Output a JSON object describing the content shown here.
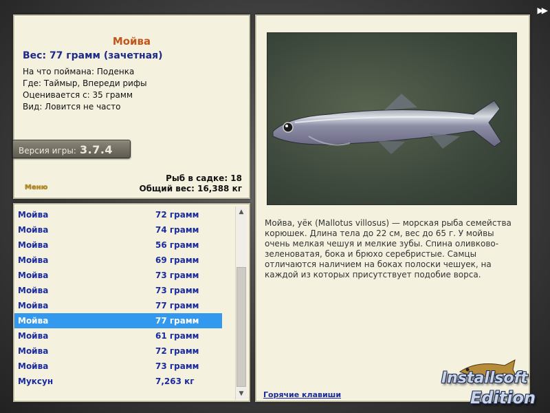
{
  "nav": {
    "arrows": "▶▶"
  },
  "info": {
    "fish_name": "Мойва",
    "weight_line": "Вес: 77 грамм (зачетная)",
    "lines": [
      "На что поймана: Поденка",
      "Где: Таймыр, Впереди рифы",
      "Оценивается с: 35 грамм",
      "Вид: Ловится не часто"
    ],
    "version_label": "Версия игры:",
    "version_number": "3.7.4",
    "menu_link": "Меню",
    "fish_in_cage": "Рыб в садке: 18",
    "total_weight": "Общий вес: 16,388 кг"
  },
  "catch_list": {
    "selected_index": 7,
    "rows": [
      {
        "name": "Мойва",
        "weight": "72 грамм"
      },
      {
        "name": "Мойва",
        "weight": "74 грамм"
      },
      {
        "name": "Мойва",
        "weight": "56 грамм"
      },
      {
        "name": "Мойва",
        "weight": "69 грамм"
      },
      {
        "name": "Мойва",
        "weight": "73 грамм"
      },
      {
        "name": "Мойва",
        "weight": "73 грамм"
      },
      {
        "name": "Мойва",
        "weight": "77 грамм"
      },
      {
        "name": "Мойва",
        "weight": "77 грамм"
      },
      {
        "name": "Мойва",
        "weight": "61 грамм"
      },
      {
        "name": "Мойва",
        "weight": "72 грамм"
      },
      {
        "name": "Мойва",
        "weight": "73 грамм"
      },
      {
        "name": "Муксун",
        "weight": "7,263 кг"
      }
    ],
    "scroll_up_glyph": "▲",
    "scroll_down_glyph": "▼"
  },
  "detail": {
    "description": "Мойва, уёк (Mallotus villosus) — морская рыба семейства корюшек. Длина тела до 22 см, вес до 65 г. У мойвы очень мелкая чешуя и мелкие зубы. Спина оливково-зеленоватая, бока и брюхо серебристые. Самцы отличаются наличием на боках полоски чешуек, на каждой из которых присутствует подобие ворса.",
    "hotkeys_link": "Горячие клавиши"
  },
  "watermark": {
    "line1": "Installsoft",
    "line2": "Edition"
  },
  "colors": {
    "panel_bg": "#f4f1df",
    "fish_name": "#c0561a",
    "list_text": "#1a2aa0",
    "selection": "#3399ee"
  }
}
